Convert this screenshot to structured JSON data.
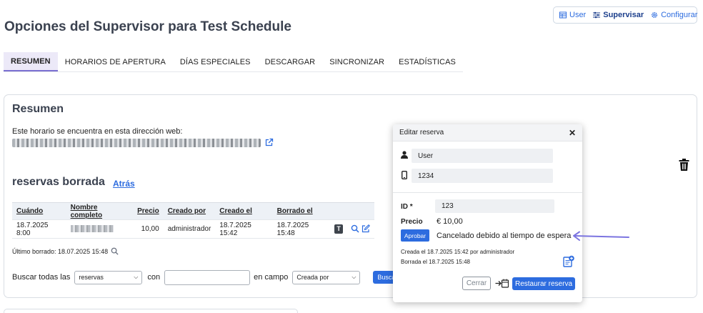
{
  "topnav": {
    "items": [
      {
        "label": "User",
        "icon": "table-icon",
        "active": false
      },
      {
        "label": "Supervisar",
        "icon": "sliders-icon",
        "active": true
      },
      {
        "label": "Configurar",
        "icon": "gear-icon",
        "active": false
      }
    ]
  },
  "page_title": "Opciones del Supervisor para Test Schedule",
  "tabs": [
    {
      "label": "RESUMEN",
      "active": true
    },
    {
      "label": "HORARIOS DE APERTURA"
    },
    {
      "label": "DÍAS ESPECIALES"
    },
    {
      "label": "DESCARGAR"
    },
    {
      "label": "SINCRONIZAR"
    },
    {
      "label": "ESTADÍSTICAS"
    }
  ],
  "summary": {
    "title": "Resumen",
    "info_line": "Este horario se encuentra en esta dirección web:"
  },
  "deleted": {
    "title": "reservas borrada",
    "back_link": "Atrás",
    "columns": [
      "Cuándo",
      "Nombre completo",
      "Precio",
      "Creado por",
      "Creado el",
      "Borrado el"
    ],
    "rows": [
      {
        "when": "18.7.2025 8:00",
        "price": "10,00",
        "created_by": "administrador",
        "created_on": "18.7.2025 15:42",
        "deleted_on": "18.7.2025 15:48",
        "badge": "T"
      }
    ],
    "last_deleted": "Último borrado: 18.07.2025 15:48"
  },
  "search": {
    "label_search_all": "Buscar todas las",
    "type_value": "reservas",
    "label_with": "con",
    "label_in_field": "en campo",
    "field_value": "Creada por",
    "button": "Buscar"
  },
  "modal": {
    "title": "Editar reserva",
    "close": "✕",
    "user_value": "User",
    "phone_value": "1234",
    "id_label": "ID *",
    "id_value": "123",
    "price_label": "Precio",
    "price_value": "€ 10,00",
    "approve_button": "Aprobar",
    "status_text": "Cancelado debido al tiempo de espera",
    "created_note": "Creada el 18.7.2025 15:42 por administrador",
    "deleted_note": "Borrada el 18.7.2025 15:48",
    "close_button": "Cerrar",
    "restore_button": "Restaurar reserva"
  },
  "colors": {
    "accent": "#2d6cdf",
    "title": "#3b4250",
    "arrow": "#7b74e0"
  }
}
